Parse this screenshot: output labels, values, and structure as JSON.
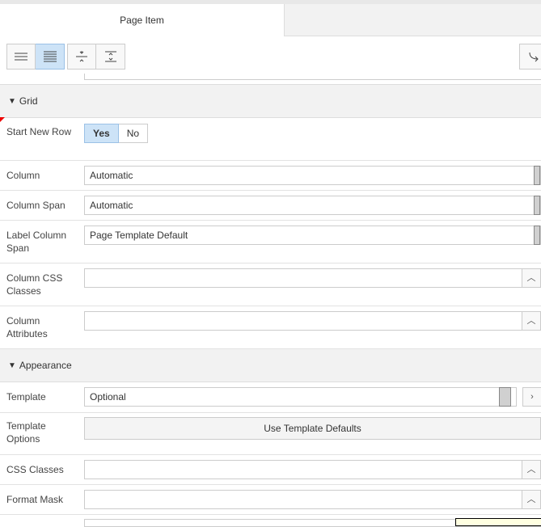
{
  "tab": {
    "label": "Page Item"
  },
  "toolbar": {
    "buttons": [
      "single-line-view",
      "multi-line-view",
      "collapse-all",
      "expand-all"
    ],
    "active": "multi-line-view"
  },
  "groups": {
    "grid": "Grid",
    "appearance": "Appearance"
  },
  "fields": {
    "start_new_row": {
      "label": "Start New Row",
      "options": [
        "Yes",
        "No"
      ],
      "value": "Yes"
    },
    "column": {
      "label": "Column",
      "value": "Automatic"
    },
    "column_span": {
      "label": "Column Span",
      "value": "Automatic"
    },
    "label_column_span": {
      "label": "Label Column Span",
      "value": "Page Template Default"
    },
    "column_css_classes": {
      "label": "Column CSS Classes",
      "value": ""
    },
    "column_attributes": {
      "label": "Column Attributes",
      "value": ""
    },
    "template": {
      "label": "Template",
      "value": "Optional"
    },
    "template_options": {
      "label": "Template Options",
      "button": "Use Template Defaults"
    },
    "css_classes": {
      "label": "CSS Classes",
      "value": ""
    },
    "format_mask": {
      "label": "Format Mask",
      "value": ""
    }
  }
}
